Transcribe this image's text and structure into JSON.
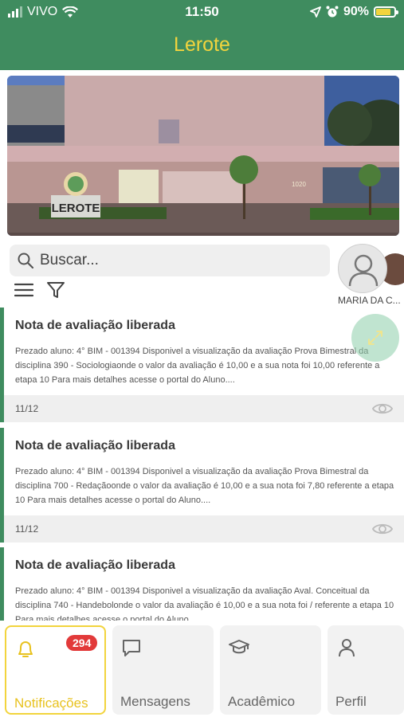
{
  "status_bar": {
    "carrier": "VIVO",
    "time": "11:50",
    "battery": "90%",
    "icons": [
      "signal-icon",
      "wifi-icon",
      "location-icon",
      "alarm-icon",
      "battery-icon"
    ]
  },
  "header": {
    "title": "Lerote"
  },
  "banner": {
    "sign_text": "LEROTE",
    "address_number": "1020"
  },
  "search": {
    "placeholder": "Buscar..."
  },
  "profile": {
    "name": "MARIA DA C..."
  },
  "notifications": [
    {
      "title": "Nota de avaliação liberada",
      "body": "Prezado aluno: 4° BIM - 001394 Disponivel a visualização da avaliação Prova Bimestral da disciplina 390 - Sociologiaonde o valor da avaliação é 10,00  e a sua nota foi 10,00 referente a etapa 10 Para mais detalhes acesse o portal do Aluno....",
      "date": "11/12"
    },
    {
      "title": "Nota de avaliação liberada",
      "body": "Prezado aluno: 4° BIM - 001394 Disponivel a visualização da avaliação Prova Bimestral da disciplina 700 - Redaçãoonde o valor da avaliação é 10,00  e a sua nota foi 7,80 referente a etapa 10 Para mais detalhes acesse o portal do Aluno....",
      "date": "11/12"
    },
    {
      "title": "Nota de avaliação liberada",
      "body": "Prezado aluno: 4° BIM - 001394 Disponivel a visualização da avaliação Aval. Conceitual da disciplina 740 - Handebolonde o valor da avaliação é 10,00  e a sua nota foi / referente a etapa 10 Para mais detalhes acesse o portal do Aluno....",
      "date": ""
    }
  ],
  "tabs": [
    {
      "label": "Notificações",
      "icon": "bell-icon",
      "badge": "294",
      "active": true
    },
    {
      "label": "Mensagens",
      "icon": "chat-icon"
    },
    {
      "label": "Acadêmico",
      "icon": "graduation-cap-icon"
    },
    {
      "label": "Perfil",
      "icon": "user-icon"
    }
  ],
  "colors": {
    "brand_green": "#3f8c5f",
    "accent_yellow": "#f2d43d",
    "badge_red": "#e23a3a"
  }
}
